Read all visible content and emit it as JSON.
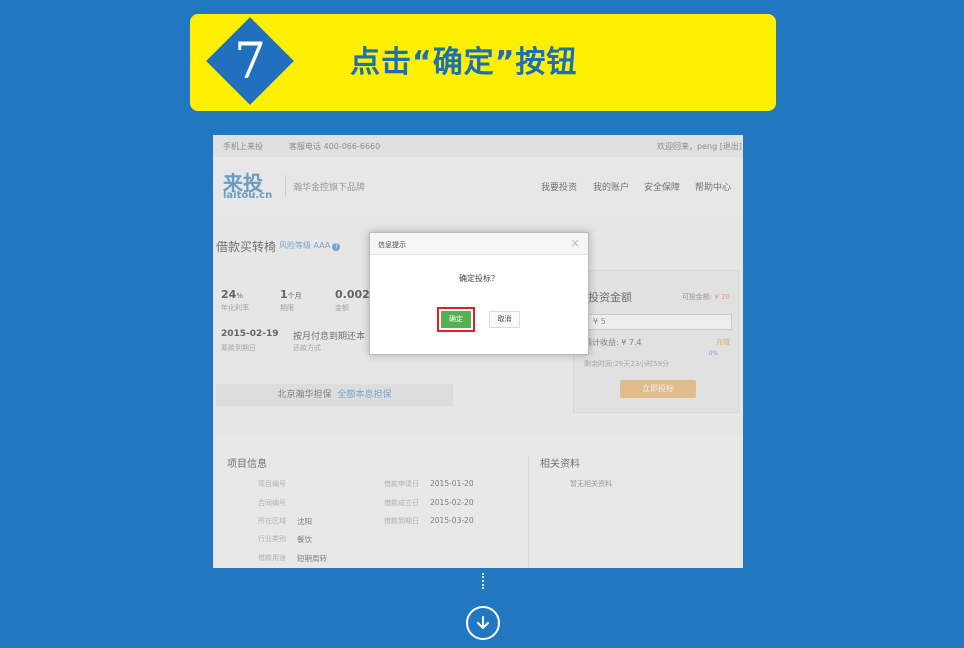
{
  "step": {
    "number": "7",
    "title": "点击“确定”按钮"
  },
  "site": {
    "topbar": {
      "mobile": "手机上来投",
      "hotline": "客服电话 400-066-6660",
      "welcome": "欢迎回来，peng [退出]"
    },
    "logo": {
      "cn": "来投",
      "en": "laitou.cn"
    },
    "slogan": "瀚华金控旗下品牌",
    "nav": [
      "我要投资",
      "我的账户",
      "安全保障",
      "帮助中心"
    ]
  },
  "product": {
    "title": "借款买转椅",
    "risk": "风险等级 AAA",
    "rate_value": "24",
    "rate_unit": "%",
    "rate_label": "年化利率",
    "term_value": "1",
    "term_unit": "个月",
    "term_label": "期限",
    "amount_value": "0.002",
    "amount_label": "金额",
    "due_date": "2015-02-19",
    "due_label": "筹款到期日",
    "repay_method": "按月付息到期还本",
    "repay_label": "还款方式",
    "guarantee": "北京瀚华担保",
    "guarantee_link": "全额本息担保"
  },
  "invest_panel": {
    "title": "投资金额",
    "available_label": "可投金额:",
    "available_value": "¥ 20",
    "amount_input": "¥ 5",
    "expected": "预计收益: ¥ 7.4",
    "recharge": "充值",
    "percent": "0%",
    "remaining": "剩余时间:29天23小时59分",
    "button": "立即投标"
  },
  "project_info": {
    "heading": "项目信息",
    "rows_left": [
      {
        "label": "项目编号",
        "value": ""
      },
      {
        "label": "合同编号",
        "value": ""
      },
      {
        "label": "所在区域",
        "value": "沈阳"
      },
      {
        "label": "行业类别",
        "value": "餐饮"
      },
      {
        "label": "借款用途",
        "value": "短期周转"
      }
    ],
    "rows_right": [
      {
        "label": "借款申请日",
        "value": "2015-01-20"
      },
      {
        "label": "借款成立日",
        "value": "2015-02-20"
      },
      {
        "label": "借款到期日",
        "value": "2015-03-20"
      }
    ]
  },
  "related": {
    "heading": "相关资料",
    "empty": "暂无相关资料"
  },
  "dialog": {
    "title": "信息提示",
    "close": "×",
    "question": "确定投标？",
    "ok": "确定",
    "cancel": "取消"
  },
  "colors": {
    "background": "#2277c1",
    "banner": "#ffef00",
    "ok_button": "#53b14f",
    "highlight_border": "#e02222"
  }
}
